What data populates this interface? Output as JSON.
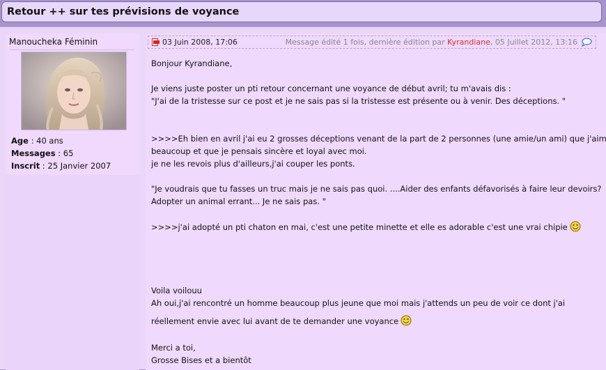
{
  "thread": {
    "title": "Retour ++ sur tes prévisions de voyance"
  },
  "user": {
    "name": "Manoucheka",
    "gender": "Féminin",
    "age_label": "Age",
    "age_value": ": 40 ans",
    "messages_label": "Messages",
    "messages_value": ": 65",
    "registered_label": "Inscrit",
    "registered_value": ": 25 Janvier 2007"
  },
  "post": {
    "date": "03 Juin 2008, 17:06",
    "edited_prefix": "Message édité 1 fois, dernière édition par",
    "edited_by": "Kyrandiane",
    "edited_when": ", 05 Juillet 2012, 13:16",
    "lines": {
      "l1": "Bonjour Kyrandiane,",
      "l2": "Je viens juste poster un pti retour concernant une voyance de début avril; tu m'avais dis :",
      "l3": "\"J'ai de la tristesse sur ce post et je ne sais pas si la tristesse est présente ou à venir. Des déceptions. \"",
      "l4": ">>>>Eh bien en avril j'ai eu 2 grosses déceptions venant de la part de 2 personnes (une amie/un ami) que j'aimais",
      "l5": "beaucoup et que je pensais sincère et loyal avec moi.",
      "l6": "je ne les revois plus d'ailleurs,j'ai couper les ponts.",
      "l7": "\"Je voudrais que tu fasses un truc mais je ne sais pas quoi. ....Aider des enfants défavorisés à faire leur devoirs?",
      "l8": "Adopter un animal errant... Je ne sais pas. \"",
      "l9": ">>>>j'ai adopté un pti chaton en mai, c'est une petite minette et elle es adorable c'est une vrai chipie",
      "l10": "Voila voilouu",
      "l11": "Ah oui,j'ai rencontré un homme beaucoup plus jeune que moi mais j'attends un peu de voir ce dont j'ai",
      "l12": "réellement envie avec lui avant de te demander une voyance",
      "l13": "Merci a toi,",
      "l14": "Grosse Bises et a bientôt"
    }
  }
}
